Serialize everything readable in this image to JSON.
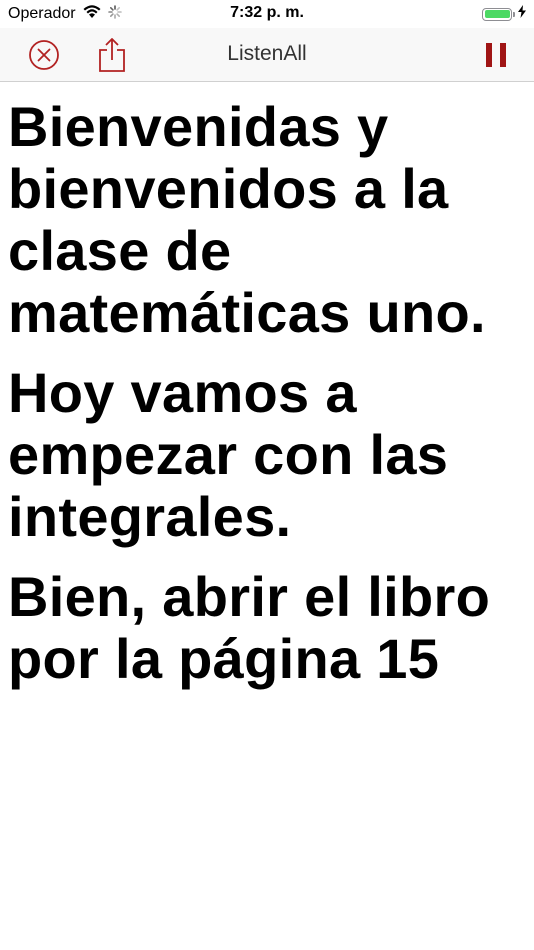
{
  "status_bar": {
    "carrier": "Operador",
    "time": "7:32 p. m.",
    "battery_level": 1.0,
    "icons": [
      "wifi-icon",
      "activity-spinner-icon",
      "battery-icon",
      "charging-bolt-icon"
    ]
  },
  "nav": {
    "title": "ListenAll",
    "left_buttons": [
      "close-circle-icon",
      "share-icon"
    ],
    "right_buttons": [
      "pause-icon"
    ],
    "accent_color": "#b22222"
  },
  "transcript": {
    "paragraphs": [
      "Bienvenidas y bienvenidos a la clase de matemáticas uno.",
      "Hoy vamos a empezar con las integrales.",
      "Bien, abrir el libro por la página 15"
    ]
  }
}
